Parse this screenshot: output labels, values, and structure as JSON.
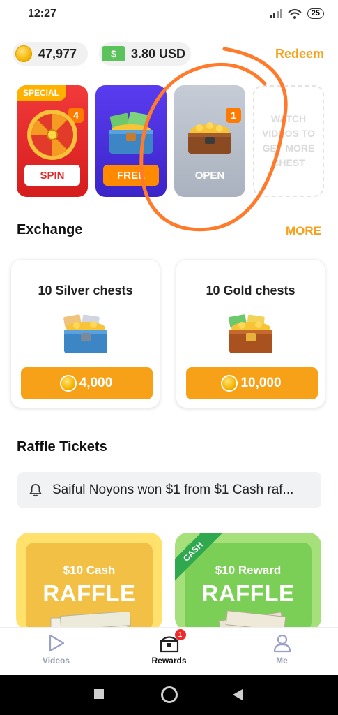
{
  "status": {
    "time": "12:27",
    "battery": "25"
  },
  "wallet": {
    "coins": "47,977",
    "cash": "3.80 USD",
    "cash_icon": "$",
    "redeem_label": "Redeem"
  },
  "chests": [
    {
      "tag": "SPECIAL",
      "badge": "4",
      "button": "SPIN"
    },
    {
      "button": "FREE"
    },
    {
      "badge": "1",
      "button": "OPEN"
    },
    {
      "text": "WATCH VIDEOS TO GET MORE CHEST"
    }
  ],
  "exchange": {
    "title": "Exchange",
    "more_label": "MORE",
    "items": [
      {
        "title": "10 Silver chests",
        "price": "4,000"
      },
      {
        "title": "10 Gold chests",
        "price": "10,000"
      }
    ]
  },
  "raffles": {
    "title": "Raffle Tickets",
    "notice": "Saiful Noyons won $1 from $1 Cash raf...",
    "cards": [
      {
        "subtitle": "$10 Cash",
        "title": "RAFFLE"
      },
      {
        "ribbon": "CASH",
        "subtitle": "$10 Reward",
        "title": "RAFFLE"
      }
    ]
  },
  "nav": [
    {
      "label": "Videos"
    },
    {
      "label": "Rewards",
      "badge": "1"
    },
    {
      "label": "Me"
    }
  ],
  "colors": {
    "accent": "#f5a11a",
    "spin_red": "#e12a2a",
    "free_purple": "#4a30dc",
    "open_gray": "#b7bec9"
  }
}
